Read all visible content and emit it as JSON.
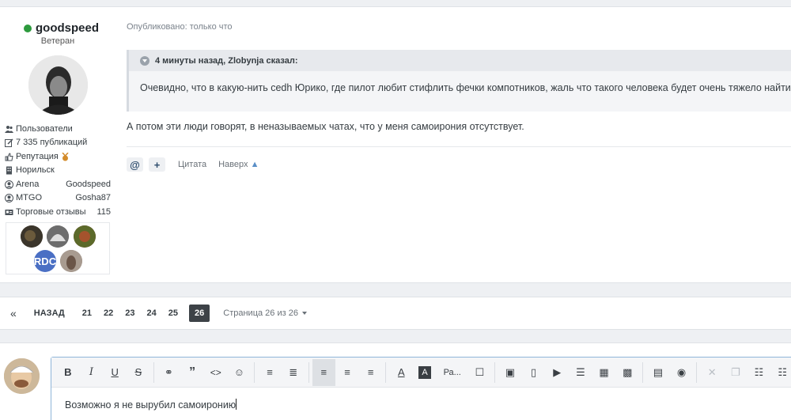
{
  "author": {
    "name": "goodspeed",
    "rank": "Ветеран",
    "info": [
      {
        "icon": "users-icon",
        "label": "Пользователи",
        "value": ""
      },
      {
        "icon": "edit-icon",
        "label": "7 335 публикаций",
        "value": ""
      },
      {
        "icon": "thumbs-up-icon",
        "label": "Репутация",
        "value": ""
      },
      {
        "icon": "building-icon",
        "label": "Норильск",
        "value": ""
      },
      {
        "icon": "user-circle-icon",
        "label": "Arena",
        "value": "Goodspeed"
      },
      {
        "icon": "user-circle-icon",
        "label": "MTGO",
        "value": "Gosha87"
      },
      {
        "icon": "id-card-icon",
        "label": "Торговые отзывы",
        "value": "115"
      }
    ],
    "badge_text": "RDC"
  },
  "post": {
    "posted": "Опубликовано: только что",
    "quote_header": "4 минуты назад, Zlobynja сказал:",
    "quote_body": "Очевидно, что в какую-нить cedh Юрико, где пилот любит стифлить фечки компотников, жаль что такого человека будет очень тяжело найти",
    "text": "А потом эти люди  говорят, в неназываемых чатах, что у меня самоирония отсутствует.",
    "actions": {
      "mention": "@",
      "plus": "+",
      "quote": "Цитата",
      "top": "Наверх"
    }
  },
  "pager": {
    "first": "«",
    "back": "НАЗАД",
    "pages": [
      "21",
      "22",
      "23",
      "24",
      "25"
    ],
    "current": "26",
    "jump": "Страница 26 из 26"
  },
  "editor": {
    "text": "Возможно я не вырубил самоиронию",
    "font_label": "Ра..."
  }
}
